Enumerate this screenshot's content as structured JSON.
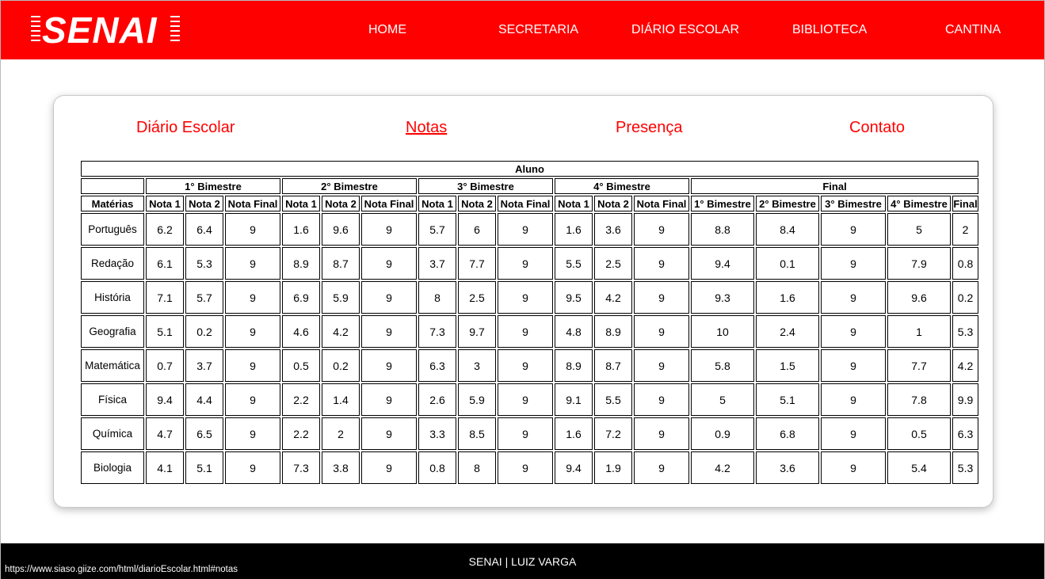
{
  "header": {
    "logo_text": "SENAI",
    "nav": [
      "HOME",
      "SECRETARIA",
      "DIÁRIO ESCOLAR",
      "BIBLIOTECA",
      "CANTINA"
    ]
  },
  "subnav": {
    "items": [
      "Diário Escolar",
      "Notas",
      "Presença",
      "Contato"
    ],
    "active": "Notas"
  },
  "table": {
    "title": "Aluno",
    "groups": [
      "1° Bimestre",
      "2° Bimestre",
      "3° Bimestre",
      "4° Bimestre",
      "Final"
    ],
    "headers": [
      "Matérias",
      "Nota 1",
      "Nota 2",
      "Nota Final",
      "Nota 1",
      "Nota 2",
      "Nota Final",
      "Nota 1",
      "Nota 2",
      "Nota Final",
      "Nota 1",
      "Nota 2",
      "Nota Final",
      "1° Bimestre",
      "2° Bimestre",
      "3° Bimestre",
      "4° Bimestre",
      "Final"
    ],
    "rows": [
      [
        "Português",
        "6.2",
        "6.4",
        "9",
        "1.6",
        "9.6",
        "9",
        "5.7",
        "6",
        "9",
        "1.6",
        "3.6",
        "9",
        "8.8",
        "8.4",
        "9",
        "5",
        "2"
      ],
      [
        "Redação",
        "6.1",
        "5.3",
        "9",
        "8.9",
        "8.7",
        "9",
        "3.7",
        "7.7",
        "9",
        "5.5",
        "2.5",
        "9",
        "9.4",
        "0.1",
        "9",
        "7.9",
        "0.8"
      ],
      [
        "História",
        "7.1",
        "5.7",
        "9",
        "6.9",
        "5.9",
        "9",
        "8",
        "2.5",
        "9",
        "9.5",
        "4.2",
        "9",
        "9.3",
        "1.6",
        "9",
        "9.6",
        "0.2"
      ],
      [
        "Geografia",
        "5.1",
        "0.2",
        "9",
        "4.6",
        "4.2",
        "9",
        "7.3",
        "9.7",
        "9",
        "4.8",
        "8.9",
        "9",
        "10",
        "2.4",
        "9",
        "1",
        "5.3"
      ],
      [
        "Matemática",
        "0.7",
        "3.7",
        "9",
        "0.5",
        "0.2",
        "9",
        "6.3",
        "3",
        "9",
        "8.9",
        "8.7",
        "9",
        "5.8",
        "1.5",
        "9",
        "7.7",
        "4.2"
      ],
      [
        "Física",
        "9.4",
        "4.4",
        "9",
        "2.2",
        "1.4",
        "9",
        "2.6",
        "5.9",
        "9",
        "9.1",
        "5.5",
        "9",
        "5",
        "5.1",
        "9",
        "7.8",
        "9.9"
      ],
      [
        "Química",
        "4.7",
        "6.5",
        "9",
        "2.2",
        "2",
        "9",
        "3.3",
        "8.5",
        "9",
        "1.6",
        "7.2",
        "9",
        "0.9",
        "6.8",
        "9",
        "0.5",
        "6.3"
      ],
      [
        "Biologia",
        "4.1",
        "5.1",
        "9",
        "7.3",
        "3.8",
        "9",
        "0.8",
        "8",
        "9",
        "9.4",
        "1.9",
        "9",
        "4.2",
        "3.6",
        "9",
        "5.4",
        "5.3"
      ]
    ]
  },
  "footer": {
    "text": "SENAI | LUIZ VARGA"
  },
  "statusbar": {
    "url": "https://www.siaso.giize.com/html/diarioEscolar.html#notas"
  },
  "colors": {
    "brand_red": "#ff0000",
    "footer_black": "#000000"
  }
}
